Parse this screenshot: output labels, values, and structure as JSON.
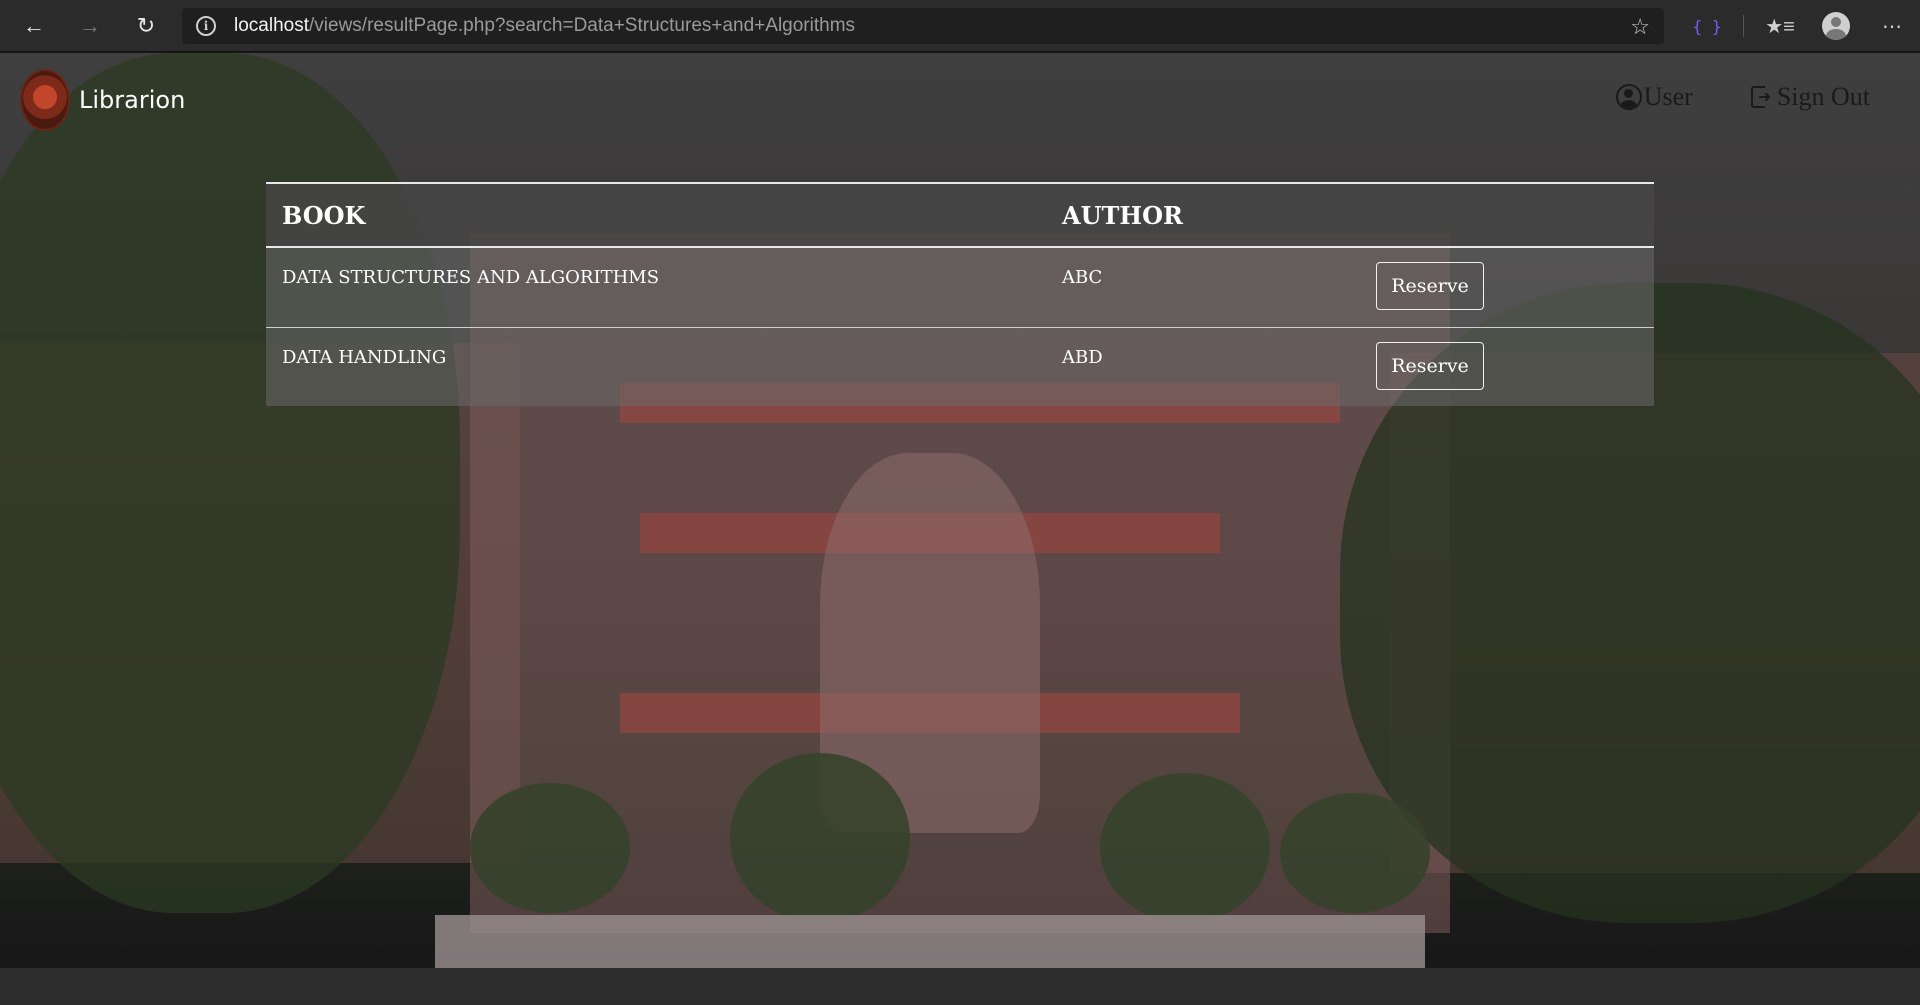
{
  "browser": {
    "url_host": "localhost",
    "url_path": "/views/resultPage.php?search=Data+Structures+and+Algorithms"
  },
  "header": {
    "brand": "Librarion",
    "user_label": "User",
    "signout_label": "Sign Out"
  },
  "table": {
    "columns": [
      "BOOK",
      "AUTHOR"
    ],
    "rows": [
      {
        "book": "DATA STRUCTURES AND ALGORITHMS",
        "author": "ABC",
        "action": "Reserve"
      },
      {
        "book": "DATA HANDLING",
        "author": "ABD",
        "action": "Reserve"
      }
    ]
  },
  "colors": {
    "chrome": "#2b2b2b",
    "header_text": "#1a1a1a",
    "table_header": "#464646"
  }
}
